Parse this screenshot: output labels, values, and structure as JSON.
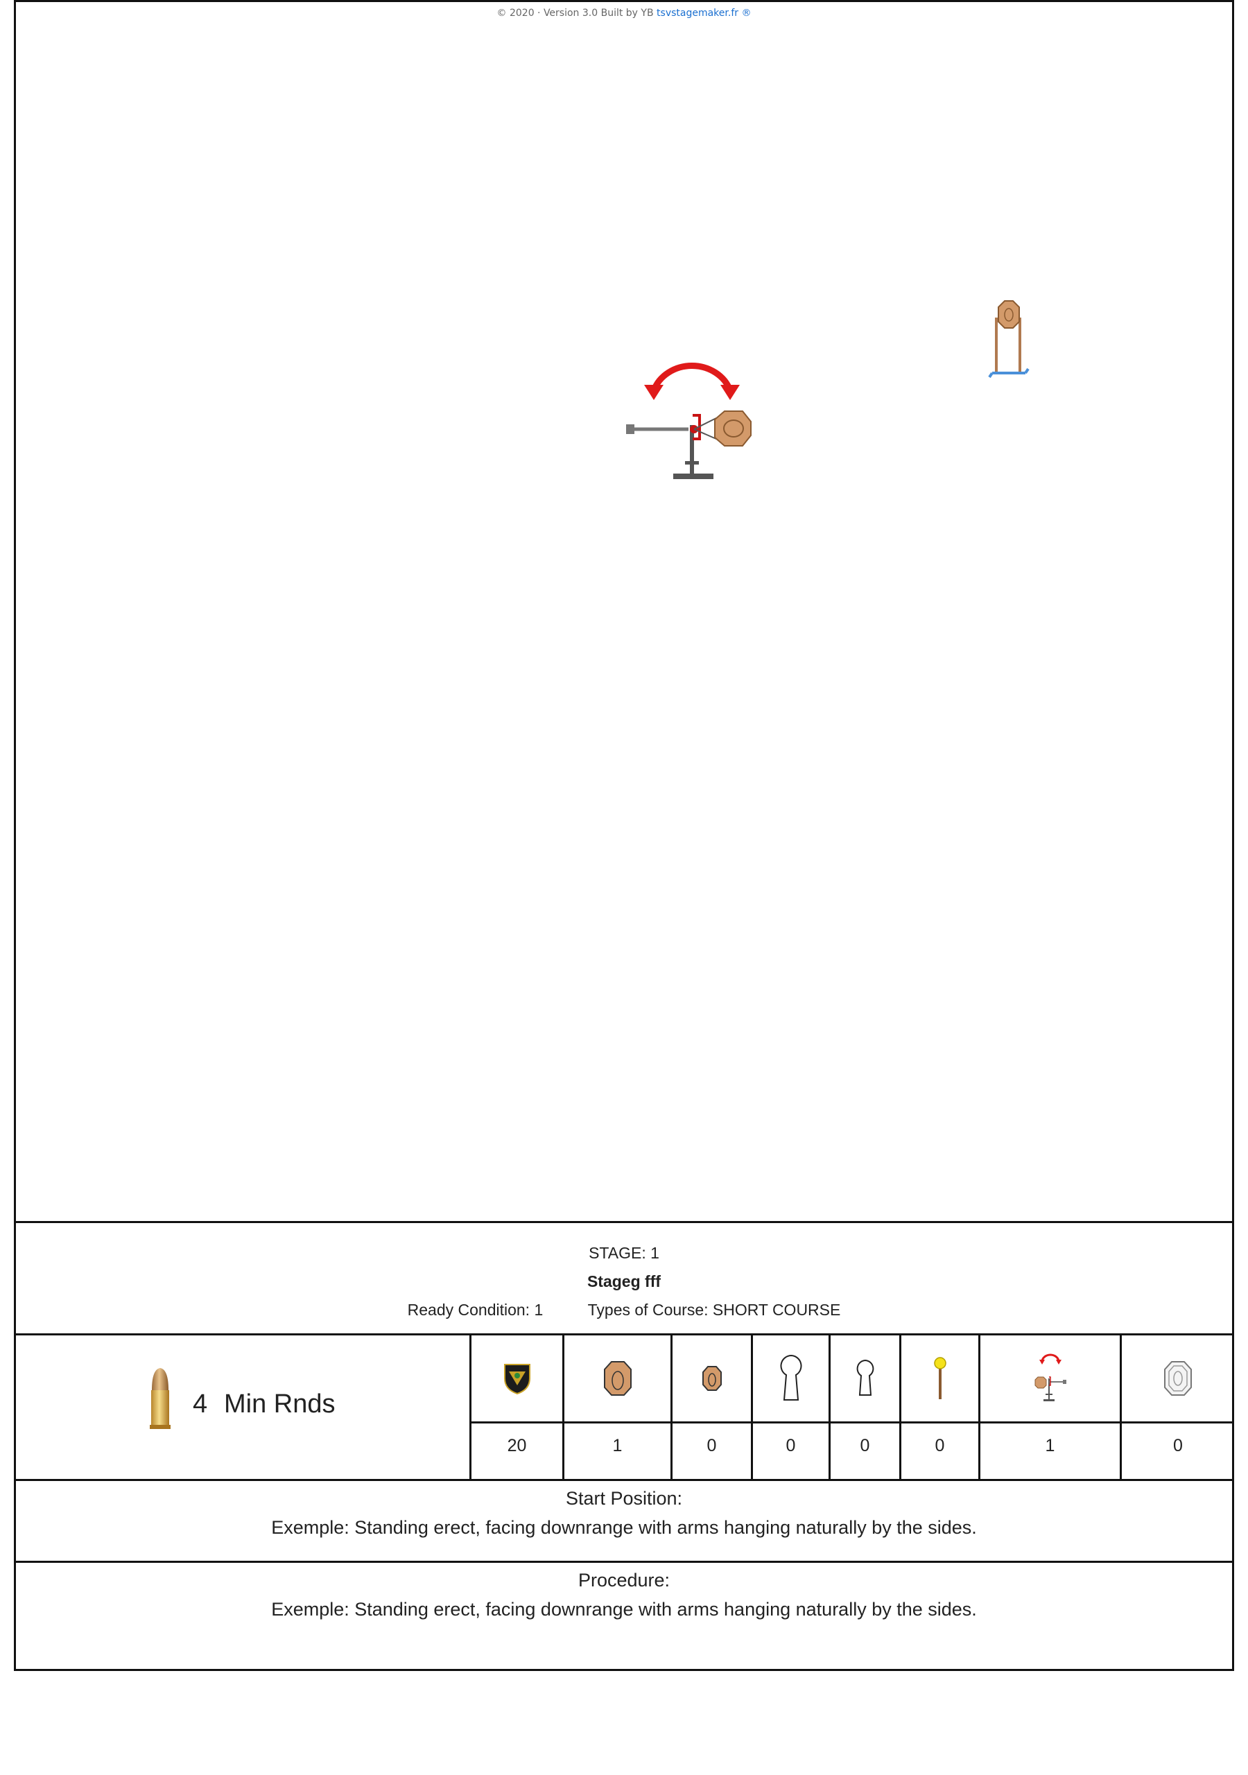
{
  "footer_copyright": {
    "text": "© 2020 · Version 3.0 Built by YB",
    "link_text": "tsvstagemaker.fr ®"
  },
  "stage_canvas": {
    "items": [
      {
        "type": "swinger-target",
        "icon": "swinger-target-icon"
      },
      {
        "type": "standing-target",
        "icon": "standing-target-icon"
      }
    ]
  },
  "stage_info": {
    "stage_label": "STAGE:",
    "stage_number": "1",
    "stage_name": "Stageg fff",
    "ready_condition_label": "Ready Condition:",
    "ready_condition_value": "1",
    "course_type_label": "Types of Course:",
    "course_type_value": "SHORT COURSE"
  },
  "rounds": {
    "count": "4",
    "label": "Min Rnds",
    "icon": "bullet-icon"
  },
  "targets": [
    {
      "icon": "shield-badge-icon",
      "value": "20"
    },
    {
      "icon": "paper-target-icon",
      "value": "1"
    },
    {
      "icon": "mini-paper-target-icon",
      "value": "0"
    },
    {
      "icon": "popper-icon",
      "value": "0"
    },
    {
      "icon": "mini-popper-icon",
      "value": "0"
    },
    {
      "icon": "plate-icon",
      "value": "0"
    },
    {
      "icon": "swinger-target-icon",
      "value": "1"
    },
    {
      "icon": "no-shoot-target-icon",
      "value": "0"
    }
  ],
  "start_position": {
    "title": "Start Position:",
    "text": "Exemple: Standing erect, facing downrange with arms hanging naturally by the sides."
  },
  "procedure": {
    "title": "Procedure:",
    "text": "Exemple: Standing erect, facing downrange with arms hanging naturally by the sides."
  },
  "colors": {
    "target_tan": "#d39a6a",
    "target_outline": "#8a5a30",
    "arrow_red": "#e01a1a",
    "stand_blue": "#4a90d9",
    "link_blue": "#1a6fd0"
  }
}
